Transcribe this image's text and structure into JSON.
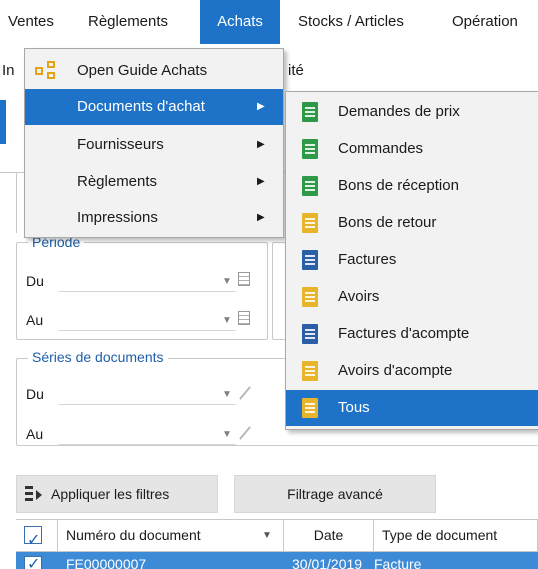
{
  "menubar": {
    "items": [
      {
        "label": "Ventes"
      },
      {
        "label": "Règlements"
      },
      {
        "label": "Achats"
      },
      {
        "label": "Stocks / Articles"
      },
      {
        "label": "Opération"
      }
    ]
  },
  "background": {
    "toolrow_left_fragment": "In",
    "toolrow_right_fragment": "ité",
    "period_group": {
      "legend": "Période",
      "from_label": "Du",
      "to_label": "Au"
    },
    "series_group": {
      "legend": "Séries de documents",
      "from_label": "Du",
      "to_label": "Au"
    },
    "apply_filters_label": "Appliquer les filtres",
    "advanced_filter_label": "Filtrage avancé",
    "grid": {
      "columns": [
        "Numéro du document",
        "Date",
        "Type de document"
      ],
      "sort_glyph": "▼",
      "first_row": {
        "number": "FE00000007",
        "date": "30/01/2019",
        "type": "Facture"
      }
    }
  },
  "achats_menu": {
    "items": [
      {
        "label": "Open Guide Achats",
        "icon": "guide-icon",
        "has_submenu": false
      },
      {
        "label": "Documents d'achat",
        "icon": "",
        "has_submenu": true
      },
      {
        "label": "Fournisseurs",
        "icon": "",
        "has_submenu": true
      },
      {
        "label": "Règlements",
        "icon": "",
        "has_submenu": true
      },
      {
        "label": "Impressions",
        "icon": "",
        "has_submenu": true
      }
    ],
    "submenu_arrow": "▶"
  },
  "documents_submenu": {
    "items": [
      {
        "label": "Demandes de prix",
        "icon": "green-document-icon"
      },
      {
        "label": "Commandes",
        "icon": "green-document-icon"
      },
      {
        "label": "Bons de réception",
        "icon": "green-document-icon"
      },
      {
        "label": "Bons de retour",
        "icon": "yellow-document-icon"
      },
      {
        "label": "Factures",
        "icon": "navy-document-icon"
      },
      {
        "label": "Avoirs",
        "icon": "yellow-document-icon"
      },
      {
        "label": "Factures d'acompte",
        "icon": "navy-document-icon"
      },
      {
        "label": "Avoirs d'acompte",
        "icon": "yellow-document-icon"
      },
      {
        "label": "Tous",
        "icon": "yellow-document-icon"
      }
    ]
  },
  "colors": {
    "highlight": "#1e73c8",
    "menu_background": "#f2f2f2",
    "legend_text": "#1f5fa8",
    "row_selected": "#3d8bd6"
  }
}
